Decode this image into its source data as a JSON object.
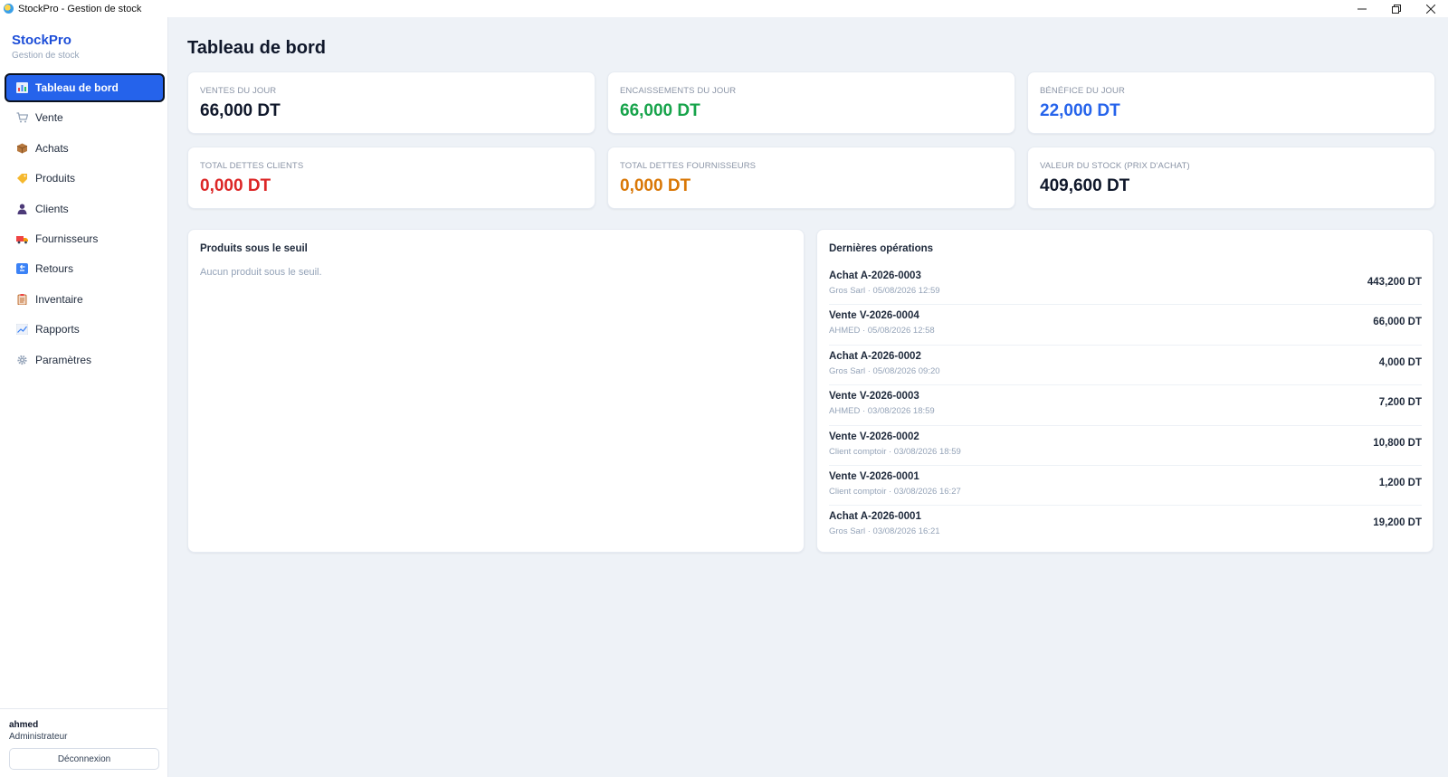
{
  "window": {
    "title": "StockPro - Gestion de stock"
  },
  "brand": {
    "name": "StockPro",
    "subtitle": "Gestion de stock"
  },
  "sidebar": {
    "items": [
      {
        "label": "Tableau de bord",
        "icon": "bar-chart-icon",
        "active": true
      },
      {
        "label": "Vente",
        "icon": "cart-icon"
      },
      {
        "label": "Achats",
        "icon": "package-icon"
      },
      {
        "label": "Produits",
        "icon": "tag-icon"
      },
      {
        "label": "Clients",
        "icon": "user-icon"
      },
      {
        "label": "Fournisseurs",
        "icon": "truck-icon"
      },
      {
        "label": "Retours",
        "icon": "return-icon"
      },
      {
        "label": "Inventaire",
        "icon": "clipboard-icon"
      },
      {
        "label": "Rapports",
        "icon": "line-chart-icon"
      },
      {
        "label": "Paramètres",
        "icon": "gear-icon"
      }
    ]
  },
  "user": {
    "name": "ahmed",
    "role": "Administrateur",
    "logout_label": "Déconnexion"
  },
  "page": {
    "title": "Tableau de bord"
  },
  "stats": [
    {
      "label": "Ventes du jour",
      "value": "66,000 DT",
      "color": "#0f172a"
    },
    {
      "label": "Encaissements du jour",
      "value": "66,000 DT",
      "color": "#16a34a"
    },
    {
      "label": "Bénéfice du jour",
      "value": "22,000 DT",
      "color": "#2563eb"
    },
    {
      "label": "Total dettes clients",
      "value": "0,000 DT",
      "color": "#dc2626"
    },
    {
      "label": "Total dettes fournisseurs",
      "value": "0,000 DT",
      "color": "#d97706"
    },
    {
      "label": "Valeur du stock (prix d'achat)",
      "value": "409,600 DT",
      "color": "#0f172a"
    }
  ],
  "low_stock": {
    "title": "Produits sous le seuil",
    "empty_text": "Aucun produit sous le seuil."
  },
  "recent_ops": {
    "title": "Dernières opérations",
    "items": [
      {
        "title": "Achat A-2026-0003",
        "sub": "Gros Sarl · 05/08/2026 12:59",
        "amount": "443,200 DT"
      },
      {
        "title": "Vente V-2026-0004",
        "sub": "AHMED · 05/08/2026 12:58",
        "amount": "66,000 DT"
      },
      {
        "title": "Achat A-2026-0002",
        "sub": "Gros Sarl · 05/08/2026 09:20",
        "amount": "4,000 DT"
      },
      {
        "title": "Vente V-2026-0003",
        "sub": "AHMED · 03/08/2026 18:59",
        "amount": "7,200 DT"
      },
      {
        "title": "Vente V-2026-0002",
        "sub": "Client comptoir · 03/08/2026 18:59",
        "amount": "10,800 DT"
      },
      {
        "title": "Vente V-2026-0001",
        "sub": "Client comptoir · 03/08/2026 16:27",
        "amount": "1,200 DT"
      },
      {
        "title": "Achat A-2026-0001",
        "sub": "Gros Sarl · 03/08/2026 16:21",
        "amount": "19,200 DT"
      }
    ]
  }
}
